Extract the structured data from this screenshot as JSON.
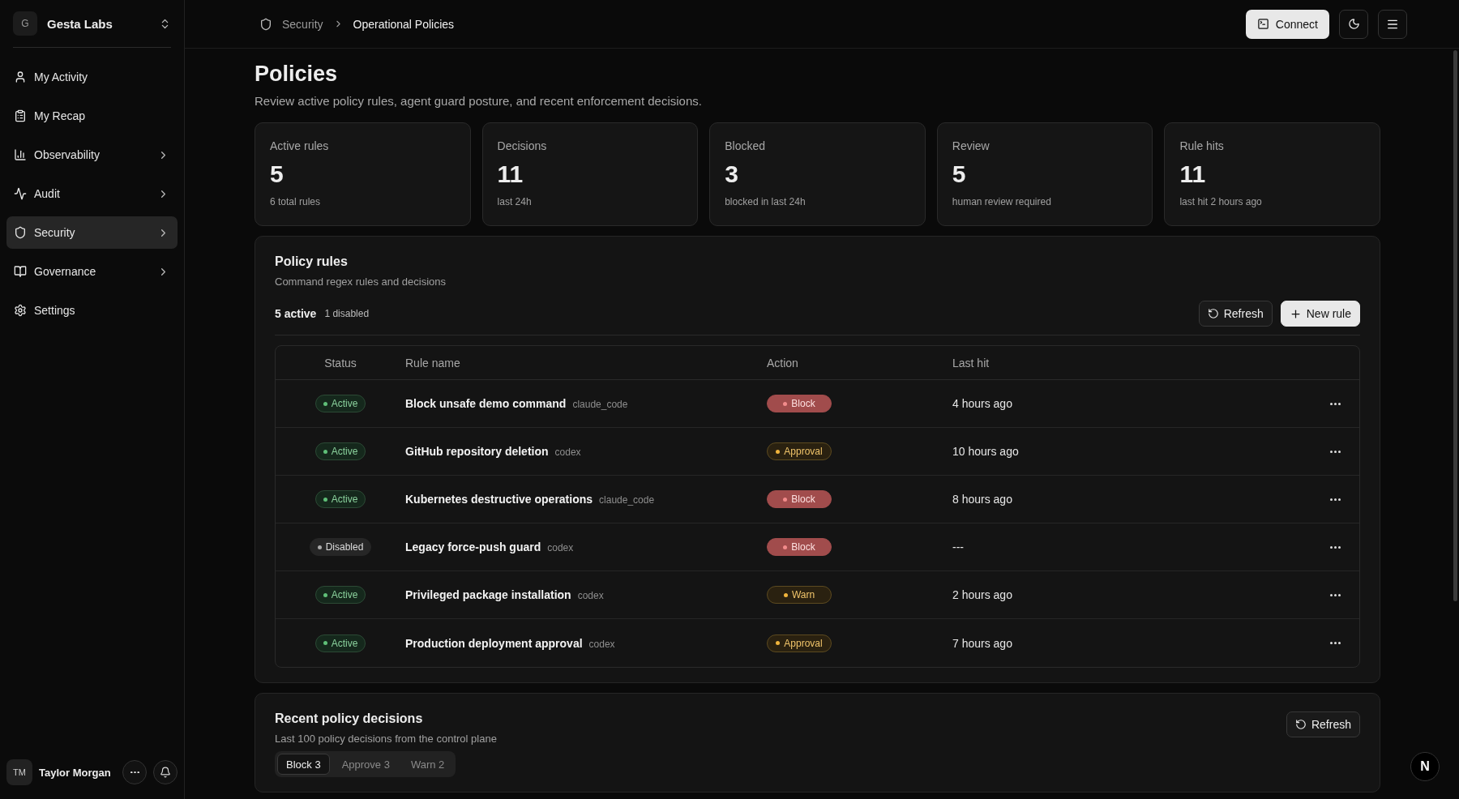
{
  "org": {
    "initial": "G",
    "name": "Gesta Labs"
  },
  "nav": [
    {
      "label": "My Activity",
      "expandable": false,
      "selected": false
    },
    {
      "label": "My Recap",
      "expandable": false,
      "selected": false
    },
    {
      "label": "Observability",
      "expandable": true,
      "selected": false
    },
    {
      "label": "Audit",
      "expandable": true,
      "selected": false
    },
    {
      "label": "Security",
      "expandable": true,
      "selected": true
    },
    {
      "label": "Governance",
      "expandable": true,
      "selected": false
    },
    {
      "label": "Settings",
      "expandable": false,
      "selected": false
    }
  ],
  "user": {
    "initials": "TM",
    "name": "Taylor Morgan"
  },
  "breadcrumb": [
    "Security",
    "Operational Policies"
  ],
  "header_buttons": {
    "connect": "Connect"
  },
  "page": {
    "title": "Policies",
    "subtitle": "Review active policy rules, agent guard posture, and recent enforcement decisions."
  },
  "stats": [
    {
      "label": "Active rules",
      "value": "5",
      "note": "6 total rules"
    },
    {
      "label": "Decisions",
      "value": "11",
      "note": "last 24h"
    },
    {
      "label": "Blocked",
      "value": "3",
      "note": "blocked in last 24h"
    },
    {
      "label": "Review",
      "value": "5",
      "note": "human review required"
    },
    {
      "label": "Rule hits",
      "value": "11",
      "note": "last hit 2 hours ago"
    }
  ],
  "policy_rules": {
    "title": "Policy rules",
    "subtitle": "Command regex rules and decisions",
    "active_count": "5 active",
    "disabled_count": "1 disabled",
    "refresh": "Refresh",
    "new_rule": "New rule",
    "columns": [
      "Status",
      "Rule name",
      "Action",
      "Last hit"
    ],
    "rows": [
      {
        "status": {
          "label": "Active",
          "kind": "active"
        },
        "name": "Block unsafe demo command",
        "agent": "claude_code",
        "action": {
          "label": "Block",
          "kind": "block"
        },
        "last_hit": "4 hours ago"
      },
      {
        "status": {
          "label": "Active",
          "kind": "active"
        },
        "name": "GitHub repository deletion",
        "agent": "codex",
        "action": {
          "label": "Approval",
          "kind": "approval"
        },
        "last_hit": "10 hours ago"
      },
      {
        "status": {
          "label": "Active",
          "kind": "active"
        },
        "name": "Kubernetes destructive operations",
        "agent": "claude_code",
        "action": {
          "label": "Block",
          "kind": "block"
        },
        "last_hit": "8 hours ago"
      },
      {
        "status": {
          "label": "Disabled",
          "kind": "disabled"
        },
        "name": "Legacy force-push guard",
        "agent": "codex",
        "action": {
          "label": "Block",
          "kind": "block"
        },
        "last_hit": "---"
      },
      {
        "status": {
          "label": "Active",
          "kind": "active"
        },
        "name": "Privileged package installation",
        "agent": "codex",
        "action": {
          "label": "Warn",
          "kind": "warn"
        },
        "last_hit": "2 hours ago"
      },
      {
        "status": {
          "label": "Active",
          "kind": "active"
        },
        "name": "Production deployment approval",
        "agent": "codex",
        "action": {
          "label": "Approval",
          "kind": "approval"
        },
        "last_hit": "7 hours ago"
      }
    ]
  },
  "recent_decisions": {
    "title": "Recent policy decisions",
    "subtitle": "Last 100 policy decisions from the control plane",
    "refresh": "Refresh",
    "tabs": [
      {
        "label": "Block 3",
        "selected": true
      },
      {
        "label": "Approve 3",
        "selected": false
      },
      {
        "label": "Warn 2",
        "selected": false
      }
    ]
  },
  "floating_badge": "N"
}
